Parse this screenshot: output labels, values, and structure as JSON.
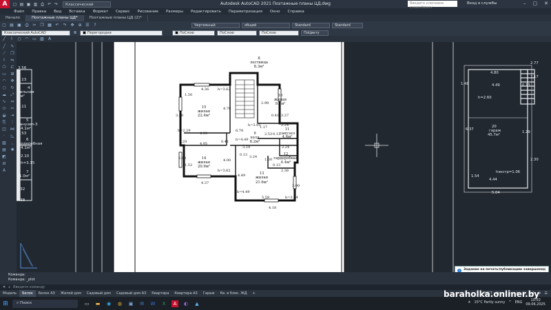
{
  "titlebar": {
    "workspace": "Классический AutoCAD",
    "title": "Autodesk AutoCAD 2021    Поэтажные планы ЦД.dwg",
    "search_placeholder": "Введите ключевое слово/фразу",
    "signin": "Вход в службы"
  },
  "menu": [
    "Файл",
    "Правка",
    "Вид",
    "Вставка",
    "Формат",
    "Сервис",
    "Рисование",
    "Размеры",
    "Редактировать",
    "Параметризация",
    "Окно",
    "Справка"
  ],
  "doctabs": [
    "Начало",
    "Поэтажные планы ЦД*",
    "Поэтажные планы ЦД (2)*"
  ],
  "toolbar1": {
    "text_style": "Чертежный",
    "dim_style": "общий",
    "table_style": "Standard",
    "mleader_style": "Standard"
  },
  "toolbar2": {
    "workspace": "Классический AutoCAD",
    "layer": "Перегородки",
    "color": "ПоСлою",
    "linetype": "ПоСлою",
    "lineweight": "ПоСлою",
    "plotstyle": "ПоЦвету"
  },
  "plan": {
    "rooms": [
      {
        "num": "8",
        "name": "лестница",
        "area": "8.3м²"
      },
      {
        "num": "15",
        "name": "жилая",
        "area": "22.4м²"
      },
      {
        "num": "10",
        "name": "жилая",
        "area": "9.7м²"
      },
      {
        "num": "11",
        "name": "санузел",
        "area": "4.6м²"
      },
      {
        "num": "9",
        "name": "холл",
        "area": "8.2м²"
      },
      {
        "num": "12",
        "name": "гардеробная",
        "area": "4.4м²"
      },
      {
        "num": "14",
        "name": "жилая",
        "area": "20.9м²"
      },
      {
        "num": "13",
        "name": "жилая",
        "area": "21.6м²"
      }
    ],
    "dims": [
      "4.36",
      "h=3.62",
      "1.50",
      "3.20",
      "4.70",
      "2.98",
      "0.41",
      "3.27",
      "h=3.95",
      "1.17",
      "6.78",
      "2.24",
      "h=2.29",
      "4.93",
      "2.53",
      "0.13",
      "4.95",
      "2.29",
      "0.41",
      "h=4.49",
      "3.24",
      "2.24",
      "0.13",
      "3.24",
      "1.50",
      "2.98",
      "4.00",
      "1.52",
      "2.36",
      "h=3.62",
      "0.13",
      "4.37",
      "4.49",
      "3.00",
      "h=4.49",
      "5.59",
      "h=3.04",
      "4.18"
    ],
    "left_labels": [
      "3.56",
      "3.13",
      "4",
      "жильная",
      "8м²",
      "3.11",
      "5",
      "санузел-3",
      "4.1м²",
      "2.53",
      "6",
      "гардеробная",
      "4.1м²",
      "2.10",
      "h=3.15",
      "7",
      "1.0м²",
      "3.32",
      "6.38"
    ],
    "right_labels": [
      "2.77",
      "4.80",
      "2.17",
      "1.48",
      "4.49",
      "0.13",
      "h=2.60",
      "6.37",
      "20",
      "гараж",
      "45.7м²",
      "1.29",
      "2.30",
      "1.54",
      "4.44",
      "hэкстр=1.06",
      "5.04"
    ]
  },
  "notification": {
    "title": "Задание на печать/публикацию завершено",
    "detail": "Ошибок и предупреждений не было",
    "link": "Просмотр подробностей о печати/публикации..."
  },
  "command": {
    "history1": "Команда:",
    "history2": "Команда:  _plot",
    "placeholder": "Введите команду"
  },
  "layouts": [
    "Модель",
    "Белок",
    "Белок А3",
    "Жилой дом",
    "Садовый дом",
    "Садовый дом А3",
    "Квартира",
    "Квартира А3",
    "Гараж",
    "Кв. в блок. ЖД"
  ],
  "status": {
    "mode": "ЛИСТ",
    "scale": "1:1"
  },
  "taskbar": {
    "search": "Поиск",
    "weather": "15°C  Partly sunny",
    "lang": "ENG",
    "time": "10:02",
    "date": "09.06.2025"
  },
  "brand": "baraholka.onliner.by",
  "colors": {
    "canvas": "#212830",
    "paper": "#ffffff",
    "logo": "#c8102e",
    "accent": "#2a7fd4"
  }
}
